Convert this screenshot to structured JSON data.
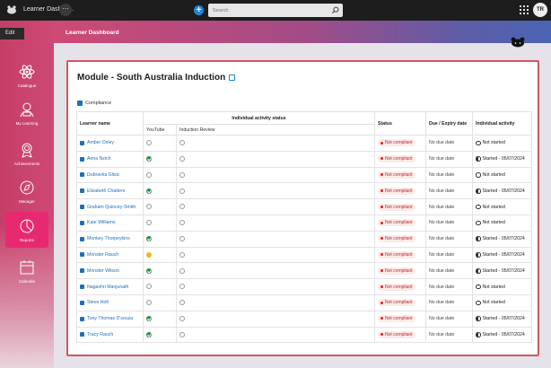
{
  "topbar": {
    "app_title": "Learner Dashbo...",
    "menu_glyph": "⋯",
    "add_glyph": "+",
    "search_placeholder": "Search",
    "avatar_initials": "TR"
  },
  "edit_label": "Edit",
  "page_header": "Learner Dashboard",
  "sidebar": {
    "items": [
      {
        "label": "Catalogue",
        "icon": "atom-icon"
      },
      {
        "label": "My Learning",
        "icon": "learner-icon"
      },
      {
        "label": "Achievements",
        "icon": "badge-icon"
      },
      {
        "label": "Manager",
        "icon": "compass-icon"
      },
      {
        "label": "Reports",
        "icon": "pie-chart-icon",
        "active": true
      },
      {
        "label": "Calendar",
        "icon": "calendar-icon"
      }
    ]
  },
  "module": {
    "title": "Module - South Australia Induction",
    "compliance_label": "Compliance"
  },
  "table": {
    "headers": {
      "learner": "Learner name",
      "activity_status": "Individual activity status",
      "status": "Status",
      "due": "Due / Expiry date",
      "individual": "Individual activity"
    },
    "subheaders": {
      "youtube": "YouTube",
      "induction": "Induction Review"
    },
    "rows": [
      {
        "name": "Amber Oxley",
        "youtube": "not-started",
        "induction": "not-started",
        "status": "Not compliant",
        "due": "No due date",
        "individual": "Not started",
        "ind_state": "empty"
      },
      {
        "name": "Anna Nzich",
        "youtube": "completed",
        "induction": "not-started",
        "status": "Not compliant",
        "due": "No due date",
        "individual": "Started - 05/07/2024",
        "ind_state": "half"
      },
      {
        "name": "Dubravka Glisic",
        "youtube": "not-started",
        "induction": "not-started",
        "status": "Not compliant",
        "due": "No due date",
        "individual": "Not started",
        "ind_state": "empty"
      },
      {
        "name": "Elizabeth Chatters",
        "youtube": "completed",
        "induction": "not-started",
        "status": "Not compliant",
        "due": "No due date",
        "individual": "Started - 05/07/2024",
        "ind_state": "half"
      },
      {
        "name": "Graham Quincey-Smith",
        "youtube": "not-started",
        "induction": "not-started",
        "status": "Not compliant",
        "due": "No due date",
        "individual": "Not started",
        "ind_state": "empty"
      },
      {
        "name": "Kate Williams",
        "youtube": "not-started",
        "induction": "not-started",
        "status": "Not compliant",
        "due": "No due date",
        "individual": "Not started",
        "ind_state": "empty"
      },
      {
        "name": "Monkey Thorpeykins",
        "youtube": "completed",
        "induction": "not-started",
        "status": "Not compliant",
        "due": "No due date",
        "individual": "Started - 05/07/2024",
        "ind_state": "half"
      },
      {
        "name": "Monster Rauch",
        "youtube": "in-progress",
        "induction": "not-started",
        "status": "Not compliant",
        "due": "No due date",
        "individual": "Started - 05/07/2024",
        "ind_state": "half"
      },
      {
        "name": "Monster Wilson",
        "youtube": "completed",
        "induction": "not-started",
        "status": "Not compliant",
        "due": "No due date",
        "individual": "Started - 05/07/2024",
        "ind_state": "half"
      },
      {
        "name": "Nagashri Manjunath",
        "youtube": "not-started",
        "induction": "not-started",
        "status": "Not compliant",
        "due": "No due date",
        "individual": "Not started",
        "ind_state": "empty"
      },
      {
        "name": "Steve Holt",
        "youtube": "not-started",
        "induction": "not-started",
        "status": "Not compliant",
        "due": "No due date",
        "individual": "Not started",
        "ind_state": "empty"
      },
      {
        "name": "Tony Thomas D'souza",
        "youtube": "completed",
        "induction": "not-started",
        "status": "Not compliant",
        "due": "No due date",
        "individual": "Started - 05/07/2024",
        "ind_state": "half"
      },
      {
        "name": "Tracy Rauch",
        "youtube": "completed",
        "induction": "not-started",
        "status": "Not compliant",
        "due": "No due date",
        "individual": "Started - 05/07/2024",
        "ind_state": "half"
      }
    ]
  },
  "colors": {
    "accent": "#1f86d8",
    "active_nav": "#e72a6f",
    "highlight_border": "#d1565f",
    "completed": "#2a8f4a",
    "not_compliant": "#c22b2b"
  }
}
